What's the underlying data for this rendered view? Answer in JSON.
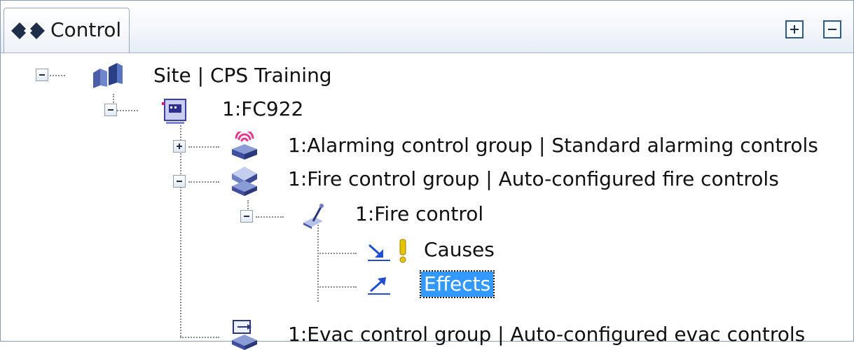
{
  "panel": {
    "tab_label": "Control",
    "expand_all_icon": "expand-all-icon",
    "collapse_all_icon": "collapse-all-icon"
  },
  "tree": {
    "nodes": [
      {
        "label": "Site | CPS Training",
        "icon": "site-icon",
        "expanded": true,
        "level": 0
      },
      {
        "label": "1:FC922",
        "icon": "panel-icon",
        "expanded": true,
        "level": 1
      },
      {
        "label": "1:Alarming control group | Standard alarming controls",
        "icon": "alarm-group-icon",
        "expanded": false,
        "level": 2
      },
      {
        "label": "1:Fire control group | Auto-configured fire controls",
        "icon": "fire-group-icon",
        "expanded": true,
        "level": 2
      },
      {
        "label": "1:Fire control",
        "icon": "fire-control-icon",
        "expanded": true,
        "level": 3
      },
      {
        "label": "Causes",
        "icon": "causes-icon",
        "warning_icon": "warning-icon",
        "level": 4
      },
      {
        "label": "Effects",
        "icon": "effects-icon",
        "selected": true,
        "level": 4
      },
      {
        "label": "1:Evac control group | Auto-configured evac controls",
        "icon": "evac-group-icon",
        "level": 2
      }
    ]
  },
  "colors": {
    "selection": "#3399ff",
    "warning": "#e8c400",
    "link_blue": "#1f4fd0"
  }
}
